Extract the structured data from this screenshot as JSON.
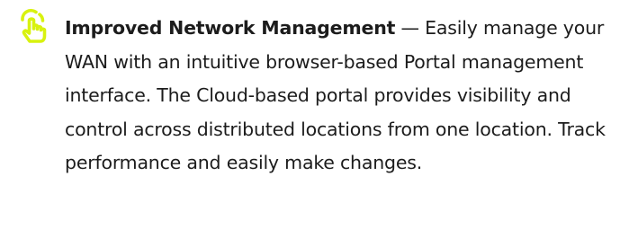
{
  "feature": {
    "icon": "pointer-hand-icon",
    "accent_color": "#d8f20f",
    "title": "Improved Network Management",
    "separator": " — ",
    "description": "Easily manage your WAN with an intuitive browser-based Portal management interface. The Cloud-based portal provides visibility and control across distributed locations from one location. Track performance and easily make changes."
  }
}
